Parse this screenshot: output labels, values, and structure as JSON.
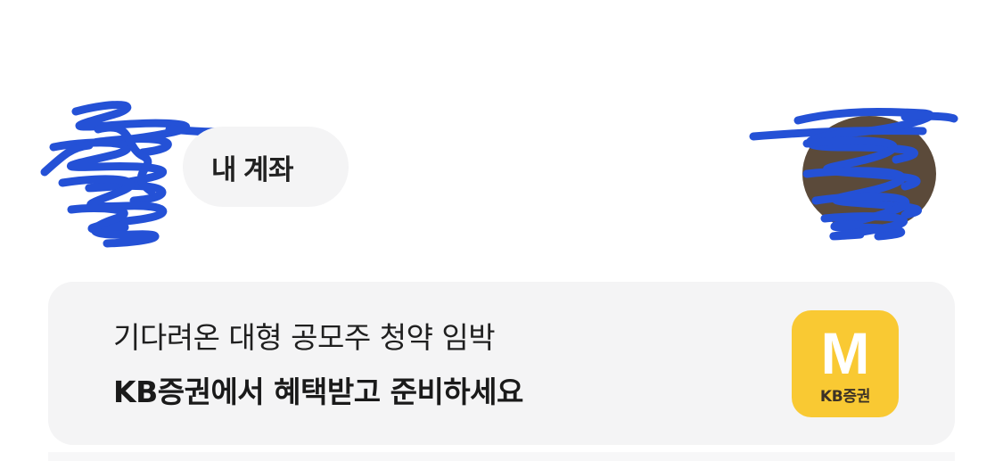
{
  "header": {
    "my_account_label": "내 계좌"
  },
  "banner": {
    "line1": "기다려온 대형 공모주 청약 임박",
    "line2": "KB증권에서 혜택받고 준비하세요",
    "logo": {
      "letter": "M",
      "caption": "KB증권",
      "color": "#f9c933"
    }
  },
  "colors": {
    "redaction": "#2451d6",
    "card_background": "#f4f4f5"
  }
}
